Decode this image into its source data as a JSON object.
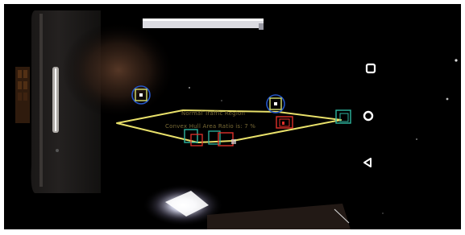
{
  "hud": {
    "region_label": "Normal Traffic Region",
    "ratio_label": "Convex Hull Area Ratio is: 7 %"
  },
  "nav_bar": {
    "recents_icon": "square-recents-icon",
    "home_icon": "circle-home-icon",
    "back_icon": "triangle-back-icon"
  },
  "colors": {
    "hull": "#e8e06a",
    "detection_red": "#e0302a",
    "detection_teal": "#2fb6a0",
    "tracker_ring": "#2456c8",
    "tracker_box": "#d8e070"
  }
}
